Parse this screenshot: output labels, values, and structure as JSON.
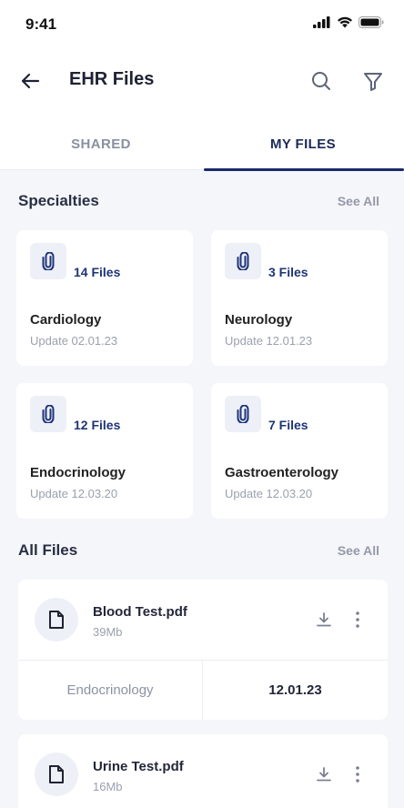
{
  "status": {
    "time": "9:41"
  },
  "header": {
    "title": "EHR Files",
    "back_icon": "arrow-left-icon",
    "search_icon": "search-icon",
    "filter_icon": "filter-icon"
  },
  "tabs": [
    {
      "label": "SHARED",
      "active": false
    },
    {
      "label": "MY FILES",
      "active": true
    }
  ],
  "specialties": {
    "title": "Specialties",
    "see_all": "See All",
    "cards": [
      {
        "count": "14 Files",
        "name": "Cardiology",
        "updated": "Update 02.01.23"
      },
      {
        "count": "3 Files",
        "name": "Neurology",
        "updated": "Update 12.01.23"
      },
      {
        "count": "12 Files",
        "name": "Endocrinology",
        "updated": "Update 12.03.20"
      },
      {
        "count": "7 Files",
        "name": "Gastroenterology",
        "updated": "Update 12.03.20"
      }
    ]
  },
  "all_files": {
    "title": "All Files",
    "see_all": "See All",
    "files": [
      {
        "name": "Blood Test.pdf",
        "size": "39Mb",
        "category": "Endocrinology",
        "date": "12.01.23"
      },
      {
        "name": "Urine Test.pdf",
        "size": "16Mb"
      }
    ]
  },
  "colors": {
    "accent": "#1b2a6b",
    "background": "#f5f6f9",
    "muted": "#9aa0ae"
  }
}
